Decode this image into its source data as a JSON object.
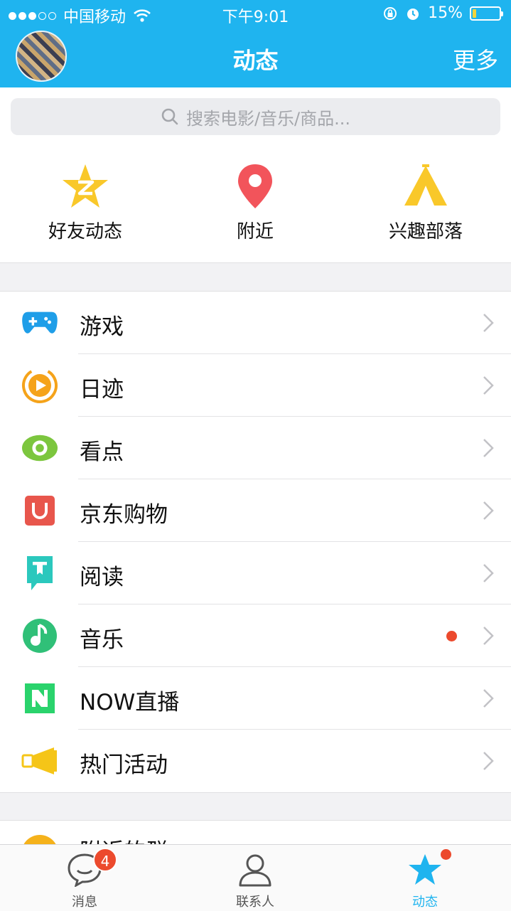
{
  "status_bar": {
    "carrier": "中国移动",
    "time": "下午9:01",
    "battery": "15%",
    "battery_level": 0.15
  },
  "nav": {
    "title": "动态",
    "more": "更多"
  },
  "search": {
    "placeholder": "搜索电影/音乐/商品..."
  },
  "quick_actions": [
    {
      "label": "好友动态",
      "icon": "qzone-star-icon"
    },
    {
      "label": "附近",
      "icon": "location-pin-icon"
    },
    {
      "label": "兴趣部落",
      "icon": "tent-icon"
    }
  ],
  "list": [
    {
      "label": "游戏",
      "icon": "gamepad-icon"
    },
    {
      "label": "日迹",
      "icon": "play-circle-icon"
    },
    {
      "label": "看点",
      "icon": "eye-icon"
    },
    {
      "label": "京东购物",
      "icon": "jd-bag-icon"
    },
    {
      "label": "阅读",
      "icon": "book-icon"
    },
    {
      "label": "音乐",
      "icon": "music-note-icon",
      "has_dot": true
    },
    {
      "label": "NOW直播",
      "icon": "now-logo-icon"
    },
    {
      "label": "热门活动",
      "icon": "megaphone-icon"
    }
  ],
  "list2": [
    {
      "label": "附近的群",
      "icon": "group-icon"
    }
  ],
  "tabs": [
    {
      "label": "消息",
      "badge": "4",
      "icon": "chat-bubble-icon"
    },
    {
      "label": "联系人",
      "icon": "person-icon"
    },
    {
      "label": "动态",
      "icon": "star-icon",
      "active": true,
      "has_dot": true
    }
  ],
  "colors": {
    "brand": "#1fb4ef",
    "red": "#ec4a2d"
  }
}
